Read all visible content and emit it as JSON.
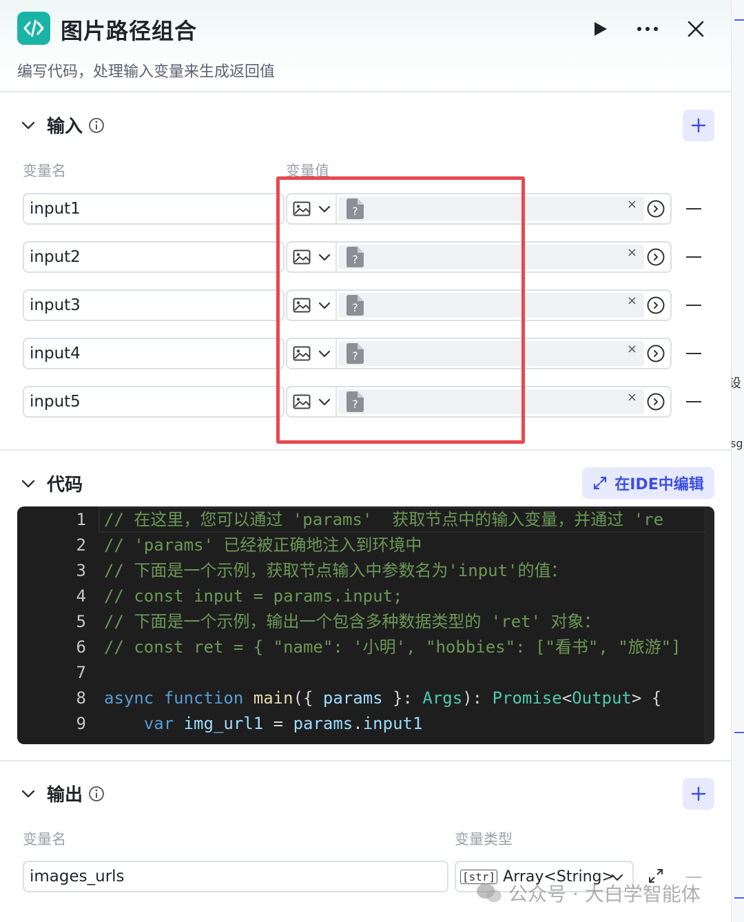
{
  "header": {
    "title": "图片路径组合",
    "subtitle": "编写代码，处理输入变量来生成返回值"
  },
  "input_section": {
    "title": "输入",
    "col_name": "变量名",
    "col_value": "变量值",
    "rows": [
      {
        "name": "input1"
      },
      {
        "name": "input2"
      },
      {
        "name": "input3"
      },
      {
        "name": "input4"
      },
      {
        "name": "input5"
      }
    ],
    "clear_symbol": "×"
  },
  "code_section": {
    "title": "代码",
    "ide_button": "在IDE中编辑",
    "lines": [
      {
        "n": "1",
        "text": "// 在这里，您可以通过 'params'  获取节点中的输入变量，并通过 're"
      },
      {
        "n": "2",
        "text": "// 'params' 已经被正确地注入到环境中"
      },
      {
        "n": "3",
        "text": "// 下面是一个示例，获取节点输入中参数名为'input'的值："
      },
      {
        "n": "4",
        "text": "// const input = params.input;"
      },
      {
        "n": "5",
        "text": "// 下面是一个示例，输出一个包含多种数据类型的 'ret' 对象："
      },
      {
        "n": "6",
        "text": "// const ret = { \"name\": '小明', \"hobbies\": [\"看书\", \"旅游\"]"
      },
      {
        "n": "7",
        "text": ""
      },
      {
        "n": "8",
        "text": "async function main({ params }: Args): Promise<Output> {"
      },
      {
        "n": "9",
        "text": "    var img_url1 = params.input1"
      }
    ]
  },
  "output_section": {
    "title": "输出",
    "col_name": "变量名",
    "col_type": "变量类型",
    "rows": [
      {
        "name": "images_urls",
        "type_tag": "[str]",
        "type": "Array<String>"
      }
    ]
  },
  "watermark": "公众号 · 大白学智能体",
  "right_strip": {
    "frag1": "设",
    "frag2": "sg"
  },
  "colors": {
    "accent": "#3b4fe3",
    "logo": "#1ab4a6",
    "highlight": "#e8484f",
    "editor_bg": "#1e1e1e"
  }
}
